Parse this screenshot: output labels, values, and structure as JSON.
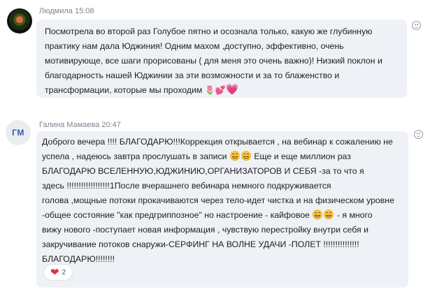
{
  "messages": [
    {
      "author": "Людмила",
      "time": "15:08",
      "header": "Людмила 15:08",
      "avatar": "photo",
      "lines": [
        "Посмотрела во второй раз Голубое пятно и осознала только, какую же глубинную",
        "практику нам дала Юджиния! Одним махом ,доступно, эффективно, очень",
        "мотивирующе,   все шаги прорисованы ( для меня это очень важно)! Низкий поклон и",
        "благодарность нашей Юджинии за эти возможности и за то блаженство и",
        "трансформации, которые мы проходим"
      ],
      "trailing_emojis": [
        "tulip",
        "two-hearts",
        "pink-heart"
      ],
      "emoji_glyphs": [
        "🌷",
        "💕",
        "💗"
      ]
    },
    {
      "author": "Галина  Мамаева",
      "time": "20:47",
      "header": "Галина  Мамаева 20:47",
      "avatar": "initials",
      "initials": "ГМ",
      "segments": {
        "l1": "Доброго вечера !!!! БЛАГОДАРЮ!!!Коррекция открывается , на вебинар к сожалению не",
        "l2a": "успела , надеюсь завтра прослушать в записи",
        "l2b": " Еще и еще миллион раз",
        "l3": "БЛАГОДАРЮ ВСЕЛЕННУЮ,ЮДЖИНИЮ,ОРГАНИЗАТОРОВ И СЕБЯ -за то что я",
        "l4": "здесь !!!!!!!!!!!!!!!!!!1После вчерашнего вебинара немного подкруживается",
        "l5": "голова ,мощные потоки прокачиваются через тело-идет чистка и на физическом уровне",
        "l6a": "-общее состояние \"как предгриппозное\" но настроение - кайфовое",
        "l6b": " - я много",
        "l7": "вижу нового -поступает новая информация , чувствую перестройку внутри себя и",
        "l8": "закручивание потоков снаружи-СЕРФИНГ НА ВОЛНЕ УДАЧИ -ПОЛЕТ !!!!!!!!!!!!!!!",
        "l9": "БЛАГОДАРЮ!!!!!!!!"
      },
      "reaction": {
        "icon": "red-heart",
        "count": "2"
      }
    }
  ],
  "icons": {
    "react": "add-reaction-smiley-icon"
  },
  "colors": {
    "bubble": "#eef1f6",
    "meta": "#7c8590",
    "initials": "#2c5fa8",
    "heart": "#e0313f"
  }
}
